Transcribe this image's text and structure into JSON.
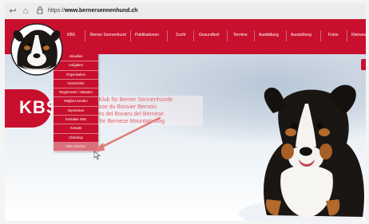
{
  "browser": {
    "url_prefix": "https://",
    "url_host": "www.bernersennenhund.ch",
    "icons": [
      "back-icon",
      "home-icon",
      "lock-icon"
    ]
  },
  "nav": {
    "items": [
      "KBS",
      "Berner Sennenhund",
      "Publikationen",
      "Zucht",
      "Gesundheit",
      "Termine",
      "Ausbildung",
      "Ausstellung",
      "Fotos",
      "Kleinanz"
    ]
  },
  "menu": {
    "items": [
      "Aktuelles",
      "Aufgaben",
      "Organisation",
      "Geschichte",
      "Reglemente / Statuten",
      "Mitglied werden",
      "Impressum",
      "Kontakte KBS",
      "Kontakt",
      "Clubshop",
      "KBS Member"
    ],
    "active_index": 10
  },
  "hero": {
    "brand": "KBS",
    "lines": [
      "cher Klub für Berner Sennenhunde",
      "b Suisse du Bouvier Bernois",
      "vizzero del Bovaro del Bernese",
      "Club for Bernese Mountain Dog"
    ]
  },
  "colors": {
    "brand_red": "#c8102e",
    "active_item": "#d9707c",
    "hero_text": "#e0616c"
  }
}
